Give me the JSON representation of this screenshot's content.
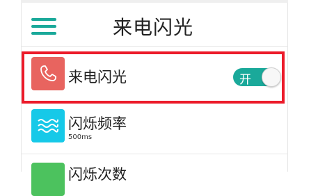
{
  "header": {
    "title": "来电闪光",
    "menu_icon": "hamburger-menu-icon"
  },
  "colors": {
    "accent": "#1aa99a",
    "highlight": "#ec1b2a",
    "phone_icon_bg": "#e8645f",
    "wave_icon_bg": "#16c9e8",
    "count_icon_bg": "#4cc25e"
  },
  "settings": [
    {
      "label": "来电闪光",
      "icon": "phone-icon",
      "toggle": {
        "state_label": "开",
        "on": true
      }
    },
    {
      "label": "闪烁频率",
      "sublabel": "500ms",
      "icon": "wave-icon"
    },
    {
      "label": "闪烁次数",
      "icon": "count-icon"
    }
  ]
}
